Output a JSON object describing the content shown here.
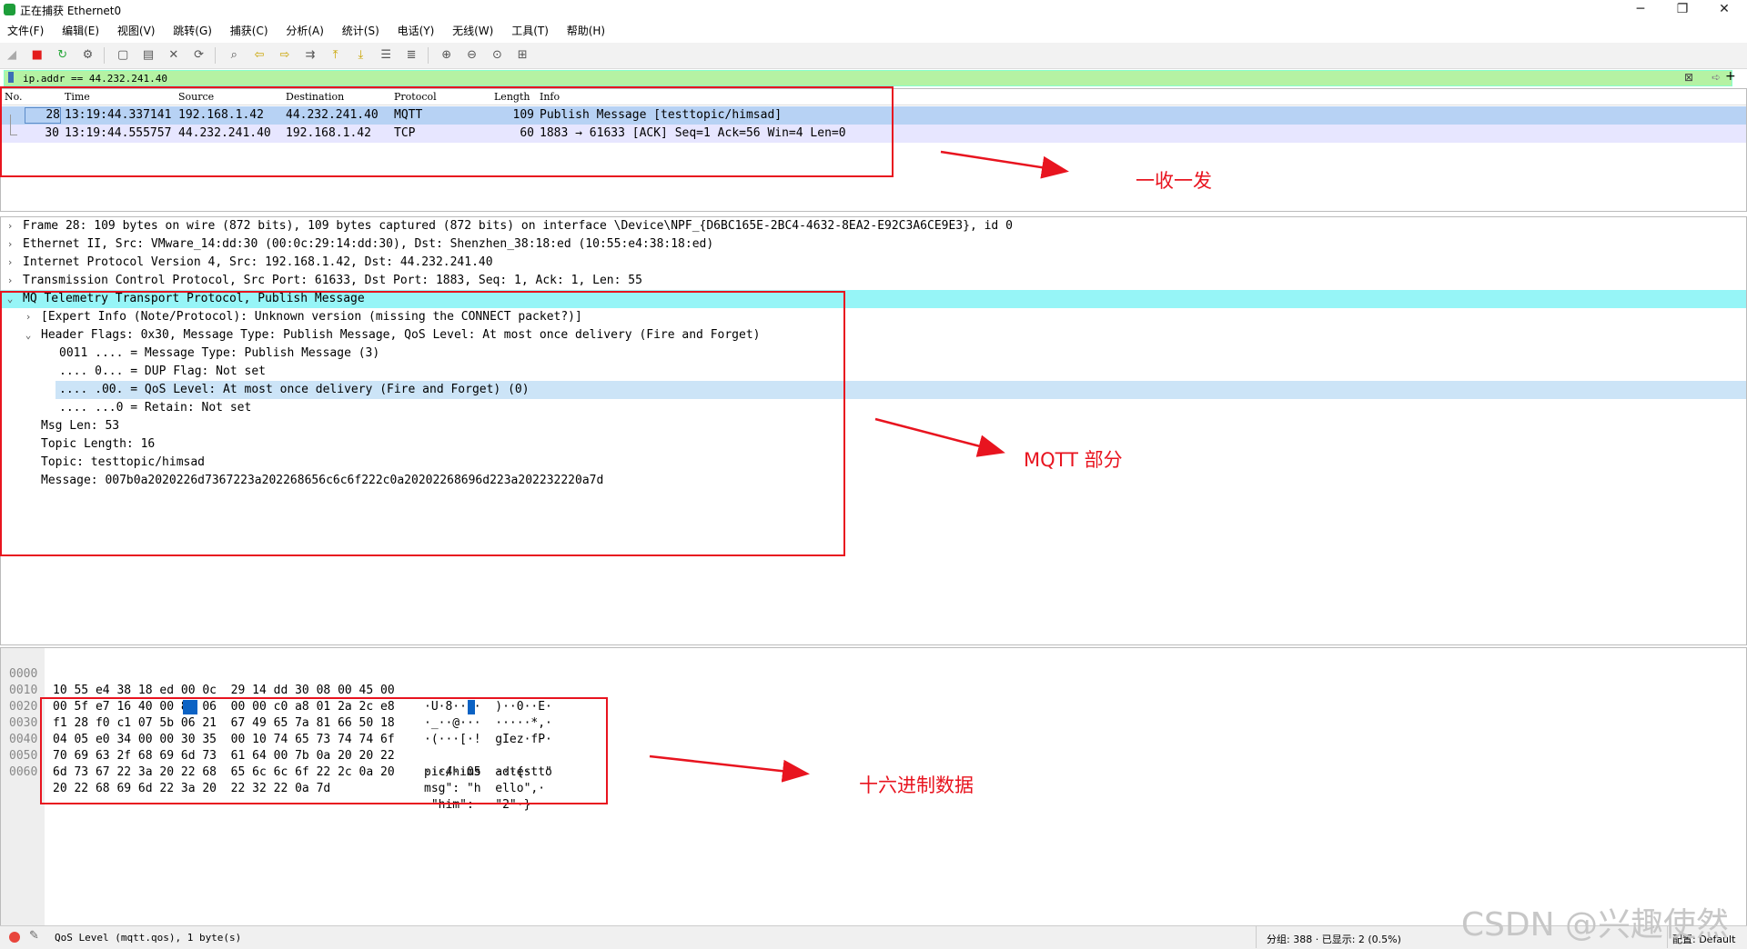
{
  "window": {
    "title": "正在捕获 Ethernet0",
    "minimize": "─",
    "restore": "❐",
    "close": "✕"
  },
  "menu": [
    "文件(F)",
    "编辑(E)",
    "视图(V)",
    "跳转(G)",
    "捕获(C)",
    "分析(A)",
    "统计(S)",
    "电话(Y)",
    "无线(W)",
    "工具(T)",
    "帮助(H)"
  ],
  "filter": {
    "value": "ip.addr == 44.232.241.40",
    "plus": "+"
  },
  "packet_list": {
    "columns": [
      "No.",
      "Time",
      "Source",
      "Destination",
      "Protocol",
      "Length",
      "Info"
    ],
    "rows": [
      {
        "no": "28",
        "time": "13:19:44.337141",
        "src": "192.168.1.42",
        "dst": "44.232.241.40",
        "proto": "MQTT",
        "len": "109",
        "info": "Publish Message [testtopic/himsad]"
      },
      {
        "no": "30",
        "time": "13:19:44.555757",
        "src": "44.232.241.40",
        "dst": "192.168.1.42",
        "proto": "TCP",
        "len": "60",
        "info": "1883 → 61633 [ACK] Seq=1 Ack=56 Win=4 Len=0"
      }
    ]
  },
  "details": [
    {
      "arrow": "›",
      "indent": 0,
      "text": "Frame 28: 109 bytes on wire (872 bits), 109 bytes captured (872 bits) on interface \\Device\\NPF_{D6BC165E-2BC4-4632-8EA2-E92C3A6CE9E3}, id 0"
    },
    {
      "arrow": "›",
      "indent": 0,
      "text": "Ethernet II, Src: VMware_14:dd:30 (00:0c:29:14:dd:30), Dst: Shenzhen_38:18:ed (10:55:e4:38:18:ed)"
    },
    {
      "arrow": "›",
      "indent": 0,
      "text": "Internet Protocol Version 4, Src: 192.168.1.42, Dst: 44.232.241.40"
    },
    {
      "arrow": "›",
      "indent": 0,
      "text": "Transmission Control Protocol, Src Port: 61633, Dst Port: 1883, Seq: 1, Ack: 1, Len: 55"
    },
    {
      "arrow": "⌄",
      "indent": 0,
      "text": "MQ Telemetry Transport Protocol, Publish Message"
    },
    {
      "arrow": "›",
      "indent": 1,
      "text": "[Expert Info (Note/Protocol): Unknown version (missing the CONNECT packet?)]"
    },
    {
      "arrow": "⌄",
      "indent": 1,
      "text": "Header Flags: 0x30, Message Type: Publish Message, QoS Level: At most once delivery (Fire and Forget)"
    },
    {
      "arrow": "",
      "indent": 2,
      "text": "0011 .... = Message Type: Publish Message (3)"
    },
    {
      "arrow": "",
      "indent": 2,
      "text": ".... 0... = DUP Flag: Not set"
    },
    {
      "arrow": "",
      "indent": 2,
      "text": ".... .00. = QoS Level: At most once delivery (Fire and Forget) (0)"
    },
    {
      "arrow": "",
      "indent": 2,
      "text": ".... ...0 = Retain: Not set"
    },
    {
      "arrow": "",
      "indent": 1,
      "text": "Msg Len: 53"
    },
    {
      "arrow": "",
      "indent": 1,
      "text": "Topic Length: 16"
    },
    {
      "arrow": "",
      "indent": 1,
      "text": "Topic: testtopic/himsad"
    },
    {
      "arrow": "",
      "indent": 1,
      "text": "Message: 007b0a2020226d7367223a202268656c6c6f222c0a20202268696d223a202232220a7d"
    }
  ],
  "bytes": [
    {
      "off": "0000",
      "hex": "10 55 e4 38 18 ed 00 0c  29 14 dd 30 08 00 45 00",
      "ascii": "·U·8····  )··0··E·"
    },
    {
      "off": "0010",
      "hex": "00 5f e7 16 40 00 80 06  00 00 c0 a8 01 2a 2c e8",
      "ascii": "·_··@···  ·····*,·"
    },
    {
      "off": "0020",
      "hex": "f1 28 f0 c1 07 5b 06 21  67 49 65 7a 81 66 50 18",
      "ascii": "·(···[·!  gIez·fP·"
    },
    {
      "off": "0030",
      "hex": "04 05 e0 34 00 00 30 35  00 10 74 65 73 74 74 6f",
      "ascii": "···4··05  ··testto"
    },
    {
      "off": "0040",
      "hex": "70 69 63 2f 68 69 6d 73  61 64 00 7b 0a 20 20 22",
      "ascii": "pic/hims  ad·{·  \""
    },
    {
      "off": "0050",
      "hex": "6d 73 67 22 3a 20 22 68  65 6c 6c 6f 22 2c 0a 20",
      "ascii": "msg\": \"h  ello\",· "
    },
    {
      "off": "0060",
      "hex": "20 22 68 69 6d 22 3a 20  22 32 22 0a 7d",
      "ascii": " \"him\":   \"2\"·}"
    }
  ],
  "status": {
    "left": "QoS Level (mqtt.qos), 1 byte(s)",
    "middle": "分组: 388 · 已显示: 2 (0.5%)",
    "right": "配置: Default"
  },
  "annotations": {
    "a1": "一收一发",
    "a2": "MQTT 部分",
    "a3": "十六进制数据"
  },
  "watermark": "CSDN @兴趣使然",
  "colors": {
    "annotation": "#e8141f",
    "filter_ok": "#b5f2a3",
    "selected_row": "#b7d2f4",
    "highlight_row": "#96f5f7",
    "byte_highlight": "#0b62c4"
  }
}
